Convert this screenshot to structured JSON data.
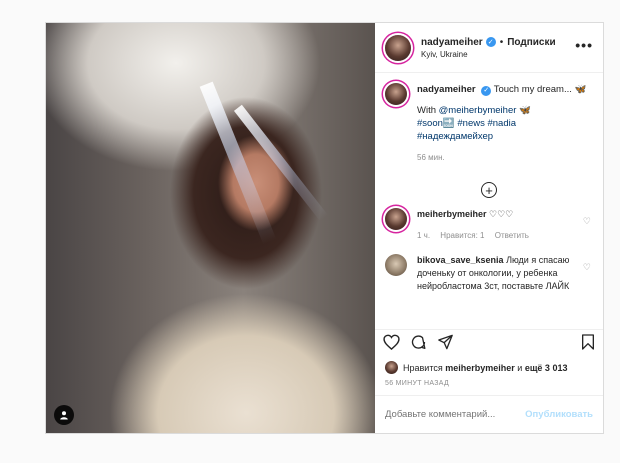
{
  "header": {
    "username": "nadyameiher",
    "separator": "•",
    "follow_label": "Подписки",
    "location": "Kyiv, Ukraine",
    "more": "•••"
  },
  "caption": {
    "username": "nadyameiher",
    "text": "Touch my dream...",
    "emoji": "🦋",
    "with_prefix": "With",
    "mention": "@meiherbymeiher",
    "tag1": "#soon",
    "soon_emoji": "🔜",
    "tag2": "#news",
    "tag3": "#nadia",
    "tag4": "#надеждамейхер",
    "time": "56 мин."
  },
  "load_more": "+",
  "comments": [
    {
      "username": "meiherbymeiher",
      "text": "♡♡♡",
      "time": "1 ч.",
      "likes": "Нравится: 1",
      "reply": "Ответить"
    },
    {
      "username": "bikova_save_ksenia",
      "text": "Люди я спасаю доченьку  от онкологии, у ребенка нейробластома 3ст, поставьте ЛАЙК"
    }
  ],
  "likes": {
    "prefix": "Нравится",
    "user": "meiherbymeiher",
    "and": "и",
    "others": "ещё 3 013"
  },
  "posted": "56 МИНУТ НАЗАД",
  "add_comment": {
    "placeholder": "Добавьте комментарий...",
    "publish": "Опубликовать"
  },
  "icons": {
    "like": "♡",
    "comment": "◯",
    "share": "➤",
    "save": "⊓",
    "heart_small": "♡",
    "user_tag": "●"
  },
  "colors": {
    "verified": "#3897f0",
    "link": "#00376b",
    "muted": "#8e8e8e",
    "publish_disabled": "#b2dffc"
  }
}
